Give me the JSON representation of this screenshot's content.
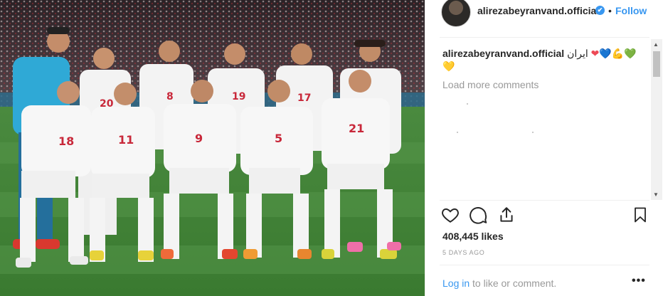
{
  "post": {
    "username": "alirezabeyranvand.official",
    "verified_mark": "✔",
    "separator": "•",
    "follow_label": "Follow",
    "caption_username": "alirezabeyranvand.official",
    "caption_text": "ایران",
    "caption_emojis": [
      "❤",
      "💙",
      "💪",
      "💚",
      "💛"
    ],
    "load_more_label": "Load more comments",
    "likes": "408,445 likes",
    "date": "5 DAYS AGO",
    "login_link": "Log in",
    "login_rest": " to like or comment.",
    "more_label": "•••",
    "icons": {
      "like": "heart-icon",
      "comment": "comment-icon",
      "share": "share-icon",
      "save": "bookmark-icon"
    }
  },
  "photo": {
    "description_numbers": [
      "20",
      "8",
      "19",
      "17",
      "18",
      "11",
      "9",
      "5",
      "21"
    ]
  },
  "colors": {
    "accent_blue": "#3897f0",
    "text": "#262626",
    "muted": "#999999",
    "heart_red": "#ed4956"
  }
}
